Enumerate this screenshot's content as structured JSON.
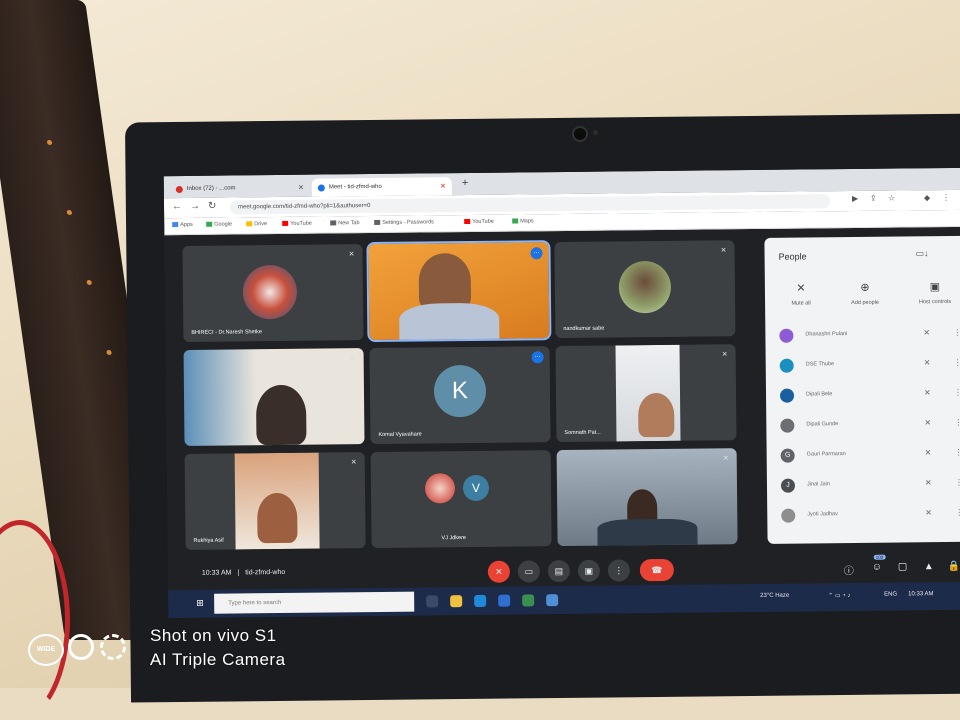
{
  "browser": {
    "tabs": [
      {
        "label": "Inbox (72) - ...com",
        "favicon_color": "#d93025"
      },
      {
        "label": "Meet - tid-zfmd-who",
        "favicon_color": "#1a73e8"
      }
    ],
    "new_tab_glyph": "+",
    "url": "meet.google.com/tid-zfmd-who?pli=1&authuser=0",
    "bookmarks": [
      "Apps",
      "Google",
      "Drive",
      "YouTube",
      "New Tab",
      "Settings - Passwords",
      "YouTube",
      "Maps"
    ]
  },
  "meet": {
    "tiles": [
      {
        "name": "BHIRECI - Dr.Naresh Shetke",
        "kind": "logo",
        "active": false
      },
      {
        "name": "",
        "kind": "video-speaker",
        "active": true
      },
      {
        "name": "nandkumar sabe",
        "kind": "photo",
        "active": false
      },
      {
        "name": "",
        "kind": "video",
        "active": false
      },
      {
        "name": "Komal Vyavahare",
        "kind": "letter",
        "letter": "K",
        "active": false
      },
      {
        "name": "Somnath Pat...",
        "kind": "video",
        "active": false
      },
      {
        "name": "Rukhiya Asif",
        "kind": "video",
        "active": false
      },
      {
        "name": "VJ Jdkere",
        "kind": "letter-logo",
        "letter": "V",
        "active": false
      },
      {
        "name": "",
        "kind": "video",
        "active": false
      }
    ],
    "time": "10:33 AM",
    "meeting_code": "tid-zfmd-who",
    "separator": "|",
    "controls": [
      "mic-off",
      "camera-off",
      "captions",
      "present",
      "more"
    ],
    "people_panel": {
      "title": "People",
      "actions": [
        {
          "label": "Mute all",
          "icon": "mic-off-icon"
        },
        {
          "label": "Add people",
          "icon": "add-person-icon"
        },
        {
          "label": "Host controls",
          "icon": "host-controls-icon"
        }
      ],
      "participants": [
        {
          "name": "Dhanashri Pulani",
          "color": "#8e5bd6",
          "initial": ""
        },
        {
          "name": "DSE Thube",
          "color": "#1b8fbf",
          "initial": ""
        },
        {
          "name": "Dipali Bele",
          "color": "#1a5fa0",
          "initial": ""
        },
        {
          "name": "Dipali Gunde",
          "color": "#6b6f74",
          "initial": ""
        },
        {
          "name": "Gauri Parmaran",
          "color": "#5f6368",
          "initial": "G"
        },
        {
          "name": "Jinal Jain",
          "color": "#4a4e53",
          "initial": "J"
        },
        {
          "name": "Jyoti Jadhav",
          "color": "#8e8e8e",
          "initial": ""
        }
      ]
    },
    "right_badge": "100"
  },
  "taskbar": {
    "search_placeholder": "Type here to search",
    "weather": "23°C",
    "weather_label": "Haze",
    "lang": "ENG",
    "clock": "10:33 AM"
  },
  "watermark": {
    "badge": "WIDE",
    "line1": "Shot on vivo S1",
    "line2": "AI Triple Camera"
  }
}
